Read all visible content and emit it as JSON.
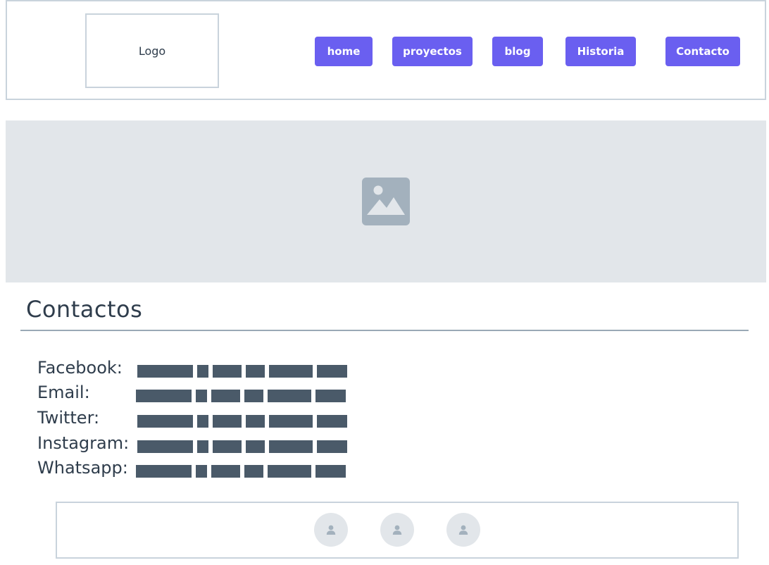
{
  "header": {
    "logo": "Logo",
    "nav": [
      {
        "label": "home"
      },
      {
        "label": "proyectos"
      },
      {
        "label": "blog"
      },
      {
        "label": "Historia"
      },
      {
        "label": "Contacto"
      }
    ]
  },
  "hero": {
    "icon": "image-placeholder-icon"
  },
  "contacts": {
    "title": "Contactos",
    "items": [
      {
        "label": "Facebook:"
      },
      {
        "label": "Email:"
      },
      {
        "label": "Twitter:"
      },
      {
        "label": "Instagram:"
      },
      {
        "label": "Whatsapp:"
      }
    ]
  },
  "footer": {
    "avatars": [
      "user-avatar-icon",
      "user-avatar-icon",
      "user-avatar-icon"
    ]
  },
  "colors": {
    "accent": "#6a5ff0",
    "border": "#c9d3dc",
    "placeholder_bg": "#e2e6ea",
    "text": "#2f3d4c",
    "redaction": "#4a5a69"
  }
}
